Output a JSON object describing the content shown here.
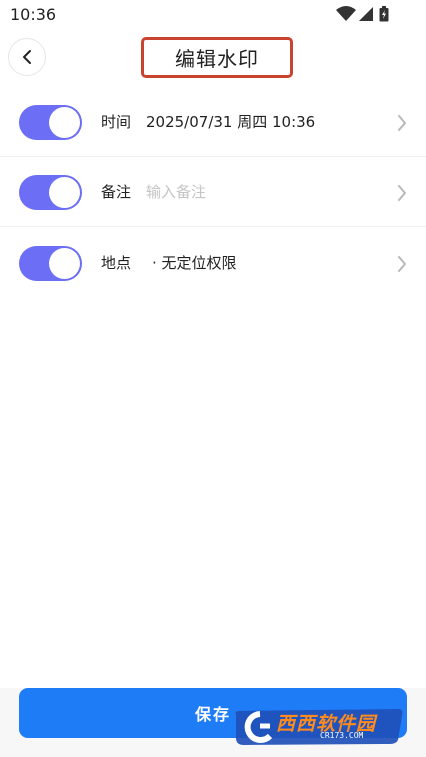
{
  "status_bar": {
    "time": "10:36",
    "icons": [
      "wifi-icon",
      "signal-icon",
      "battery-icon"
    ]
  },
  "header": {
    "back_icon": "chevron-left-icon",
    "title": "编辑水印"
  },
  "settings": {
    "time": {
      "label": "时间",
      "value": "2025/07/31 周四 10:36",
      "enabled": true
    },
    "note": {
      "label": "备注",
      "placeholder": "输入备注",
      "enabled": true
    },
    "location": {
      "label": "地点",
      "value": "· 无定位权限",
      "enabled": true
    }
  },
  "footer": {
    "save_label": "保存"
  },
  "watermark": {
    "text": "西西软件园",
    "sub": "CR173.COM"
  },
  "colors": {
    "toggle_on": "#6c6ef5",
    "save_button": "#1e7cf7",
    "title_highlight": "#c9442f"
  }
}
